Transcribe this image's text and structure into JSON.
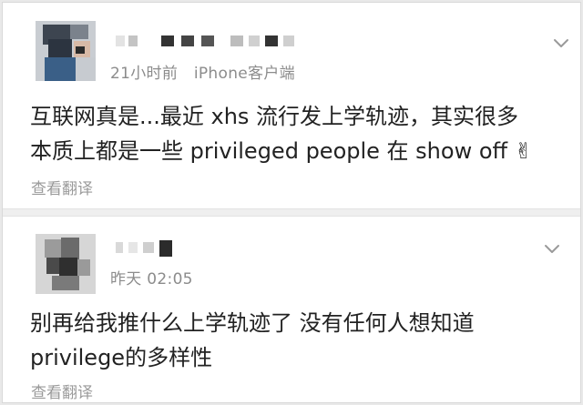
{
  "posts": [
    {
      "time": "21小时前",
      "device": "iPhone客户端",
      "lines": [
        "互联网真是...最近 xhs 流行发上学轨迹，其实很多",
        "本质上都是一些 privileged people 在 show off ✌"
      ],
      "translate_label": "查看翻译"
    },
    {
      "time": "昨天 02:05",
      "lines": [
        "别再给我推什么上学轨迹了 没有任何人想知道",
        "privilege的多样性"
      ],
      "translate_label": "查看翻译"
    }
  ],
  "colors": {
    "meta_text": "#8c8c8c",
    "body_text": "#222222",
    "translate_text": "#9a9a9a",
    "divider": "#efefef"
  },
  "icons": {
    "expand": "chevron-down-icon",
    "emoji": "victory-hand-emoji"
  }
}
